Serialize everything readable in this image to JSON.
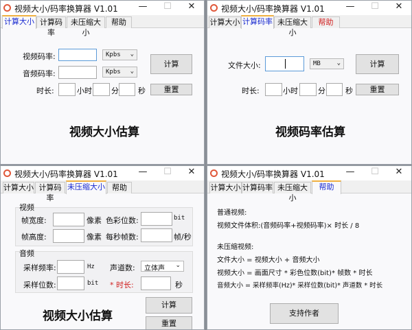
{
  "app_title": "视频大小/码率换算器 V1.01",
  "tabs": [
    "计算大小",
    "计算码率",
    "未压缩大小",
    "帮助"
  ],
  "colors": {
    "active_tab": "#1a2bd0",
    "help_tab_red": "#d02020",
    "required": "#d02020",
    "tab_accent": "#f0b040"
  },
  "size_tab": {
    "video_bitrate_label": "视频码率:",
    "audio_bitrate_label": "音频码率:",
    "video_unit": "Kpbs",
    "audio_unit": "Kpbs",
    "duration_label": "时长:",
    "hour": "小时",
    "minute": "分",
    "second": "秒",
    "calc": "计算",
    "reset": "重置",
    "heading": "视频大小估算"
  },
  "bitrate_tab": {
    "file_size_label": "文件大小:",
    "unit": "MB",
    "duration_label": "时长:",
    "hour": "小时",
    "minute": "分",
    "second": "秒",
    "calc": "计算",
    "reset": "重置",
    "heading": "视频码率估算"
  },
  "raw_tab": {
    "video_group": "视频",
    "frame_width": "帧宽度:",
    "frame_height": "帧高度:",
    "pixel": "像素",
    "color_depth": "色彩位数:",
    "bit": "bit",
    "fps": "每秒帧数:",
    "fps_unit": "帧/秒",
    "audio_group": "音频",
    "sample_rate": "采样频率:",
    "hz": "Hz",
    "channels": "声道数:",
    "channels_value": "立体声",
    "sample_bits": "采样位数:",
    "duration_star": "* 时长:",
    "second": "秒",
    "calc": "计算",
    "reset": "重置",
    "heading": "视频大小估算"
  },
  "help_tab": {
    "lines": [
      "普通视频:",
      "视频文件体积:(音频码率+视频码率)× 时长 / 8",
      "未压缩视频:",
      "文件大小 = 视频大小 + 音频大小",
      "视频大小 = 画面尺寸 * 彩色位数(bit)* 帧数 * 时长",
      "音频大小 = 采样频率(Hz)* 采样位数(bit)* 声道数 * 时长"
    ],
    "support": "支持作者"
  }
}
